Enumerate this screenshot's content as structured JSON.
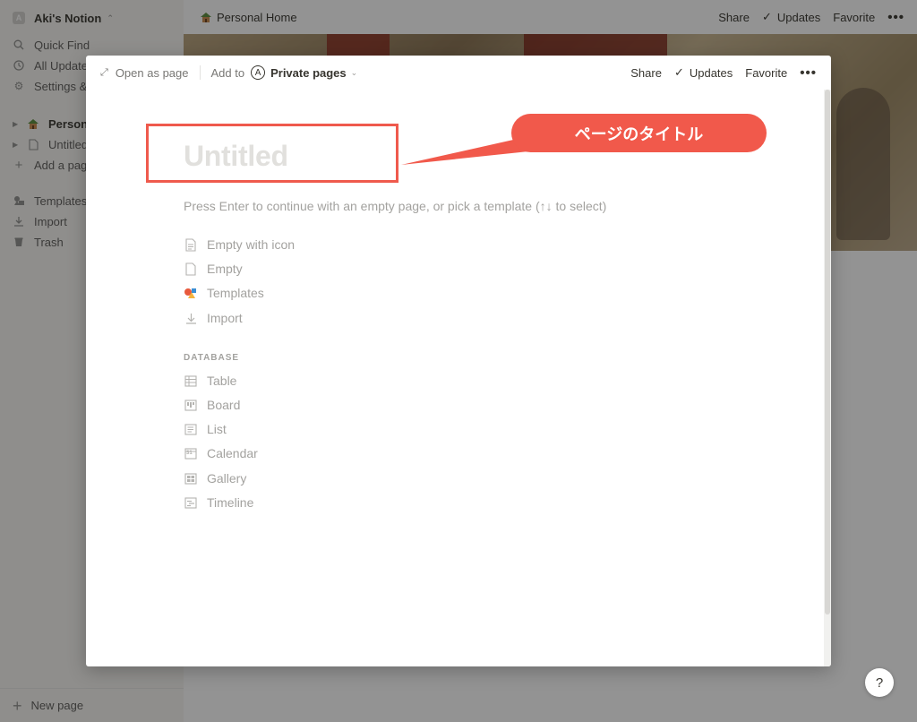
{
  "sidebar": {
    "workspace_avatar": "A",
    "workspace_name": "Aki's Notion",
    "items": [
      {
        "icon": "search-icon",
        "label": "Quick Find"
      },
      {
        "icon": "clock-icon",
        "label": "All Updates"
      },
      {
        "icon": "gear-icon",
        "label": "Settings & Members"
      }
    ],
    "pages": [
      {
        "icon": "house-emoji-icon",
        "label": "Personal Home"
      },
      {
        "icon": "page-icon",
        "label": "Untitled"
      }
    ],
    "add_page": "Add a page",
    "tools": [
      {
        "icon": "templates-icon",
        "label": "Templates"
      },
      {
        "icon": "import-icon",
        "label": "Import"
      },
      {
        "icon": "trash-icon",
        "label": "Trash"
      }
    ],
    "new_page": "New page"
  },
  "topbar": {
    "breadcrumb": "Personal Home",
    "share": "Share",
    "updates": "Updates",
    "favorite": "Favorite"
  },
  "modal": {
    "open_as_page": "Open as page",
    "add_to": "Add to",
    "location_avatar": "A",
    "location": "Private pages",
    "share": "Share",
    "updates": "Updates",
    "favorite": "Favorite",
    "title_placeholder": "Untitled",
    "hint": "Press Enter to continue with an empty page, or pick a template (↑↓ to select)",
    "options": [
      {
        "icon": "page-with-lines-icon",
        "label": "Empty with icon"
      },
      {
        "icon": "blank-page-icon",
        "label": "Empty"
      },
      {
        "icon": "templates-icon",
        "label": "Templates"
      },
      {
        "icon": "import-icon",
        "label": "Import"
      }
    ],
    "database_heading": "DATABASE",
    "database_options": [
      {
        "icon": "table-icon",
        "label": "Table"
      },
      {
        "icon": "board-icon",
        "label": "Board"
      },
      {
        "icon": "list-icon",
        "label": "List"
      },
      {
        "icon": "calendar-icon",
        "label": "Calendar",
        "glyph": "31"
      },
      {
        "icon": "gallery-icon",
        "label": "Gallery"
      },
      {
        "icon": "timeline-icon",
        "label": "Timeline"
      }
    ]
  },
  "annotation": {
    "label": "ページのタイトル",
    "color": "#f1594b"
  },
  "help": "?"
}
